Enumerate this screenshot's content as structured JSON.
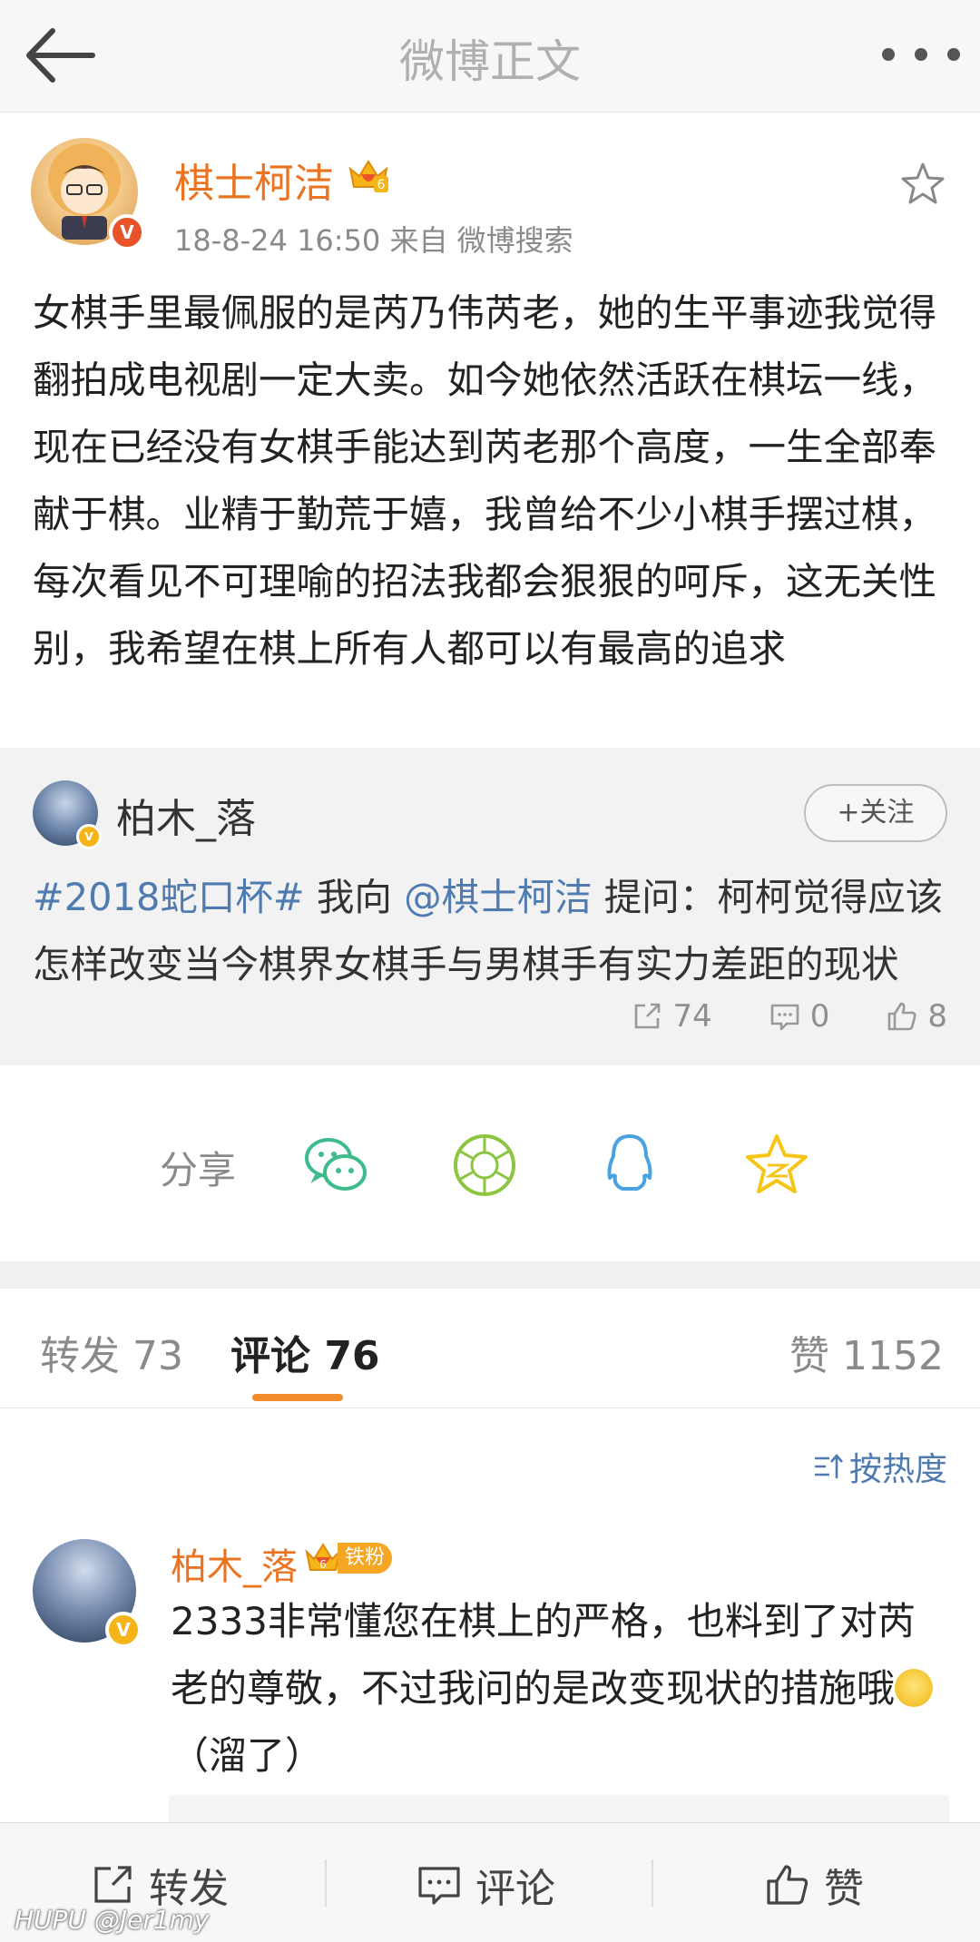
{
  "nav": {
    "title": "微博正文"
  },
  "post": {
    "author": "棋士柯洁",
    "vip_level": "6",
    "meta": "18-8-24 16:50   来自 微博搜索",
    "body": "女棋手里最佩服的是芮乃伟芮老，她的生平事迹我觉得翻拍成电视剧一定大卖。如今她依然活跃在棋坛一线，现在已经没有女棋手能达到芮老那个高度，一生全部奉献于棋。业精于勤荒于嬉，我曾给不少小棋手摆过棋，每次看见不可理喻的招法我都会狠狠的呵斥，这无关性别，我希望在棋上所有人都可以有最高的追求"
  },
  "quote": {
    "author": "柏木_落",
    "follow_label": "+关注",
    "hashtag": "#2018蛇口杯#",
    "text_mid": " 我向 ",
    "mention": "@棋士柯洁",
    "text_rest": " 提问：柯柯觉得应该怎样改变当今棋界女棋手与男棋手有实力差距的现状",
    "reposts": "74",
    "comments": "0",
    "likes": "8"
  },
  "share": {
    "label": "分享",
    "icons": [
      "wechat-icon",
      "moments-icon",
      "qq-icon",
      "qzone-icon"
    ]
  },
  "tabs": {
    "repost": "转发 73",
    "comment": "评论 76",
    "like": "赞 1152"
  },
  "sort_label": "按热度",
  "comment": {
    "author": "柏木_落",
    "vip_level": "6",
    "fan_tag": "铁粉",
    "text_before": "2333非常懂您在棋上的严格，也料到了对芮老的尊敬，不过我问的是改变现状的措施哦",
    "text_after": "（溜了）"
  },
  "bottombar": {
    "repost": "转发",
    "comment": "评论",
    "like": "赞"
  },
  "watermark": "HUPU @Jer1my",
  "colors": {
    "accent_orange": "#eb7320",
    "link_blue": "#4f7bb0",
    "tab_underline": "#f08c2a",
    "wechat_green": "#3dbb8a",
    "moments_green": "#8cc540",
    "qq_blue": "#4aa3e0",
    "qzone_yellow": "#f5c518"
  }
}
